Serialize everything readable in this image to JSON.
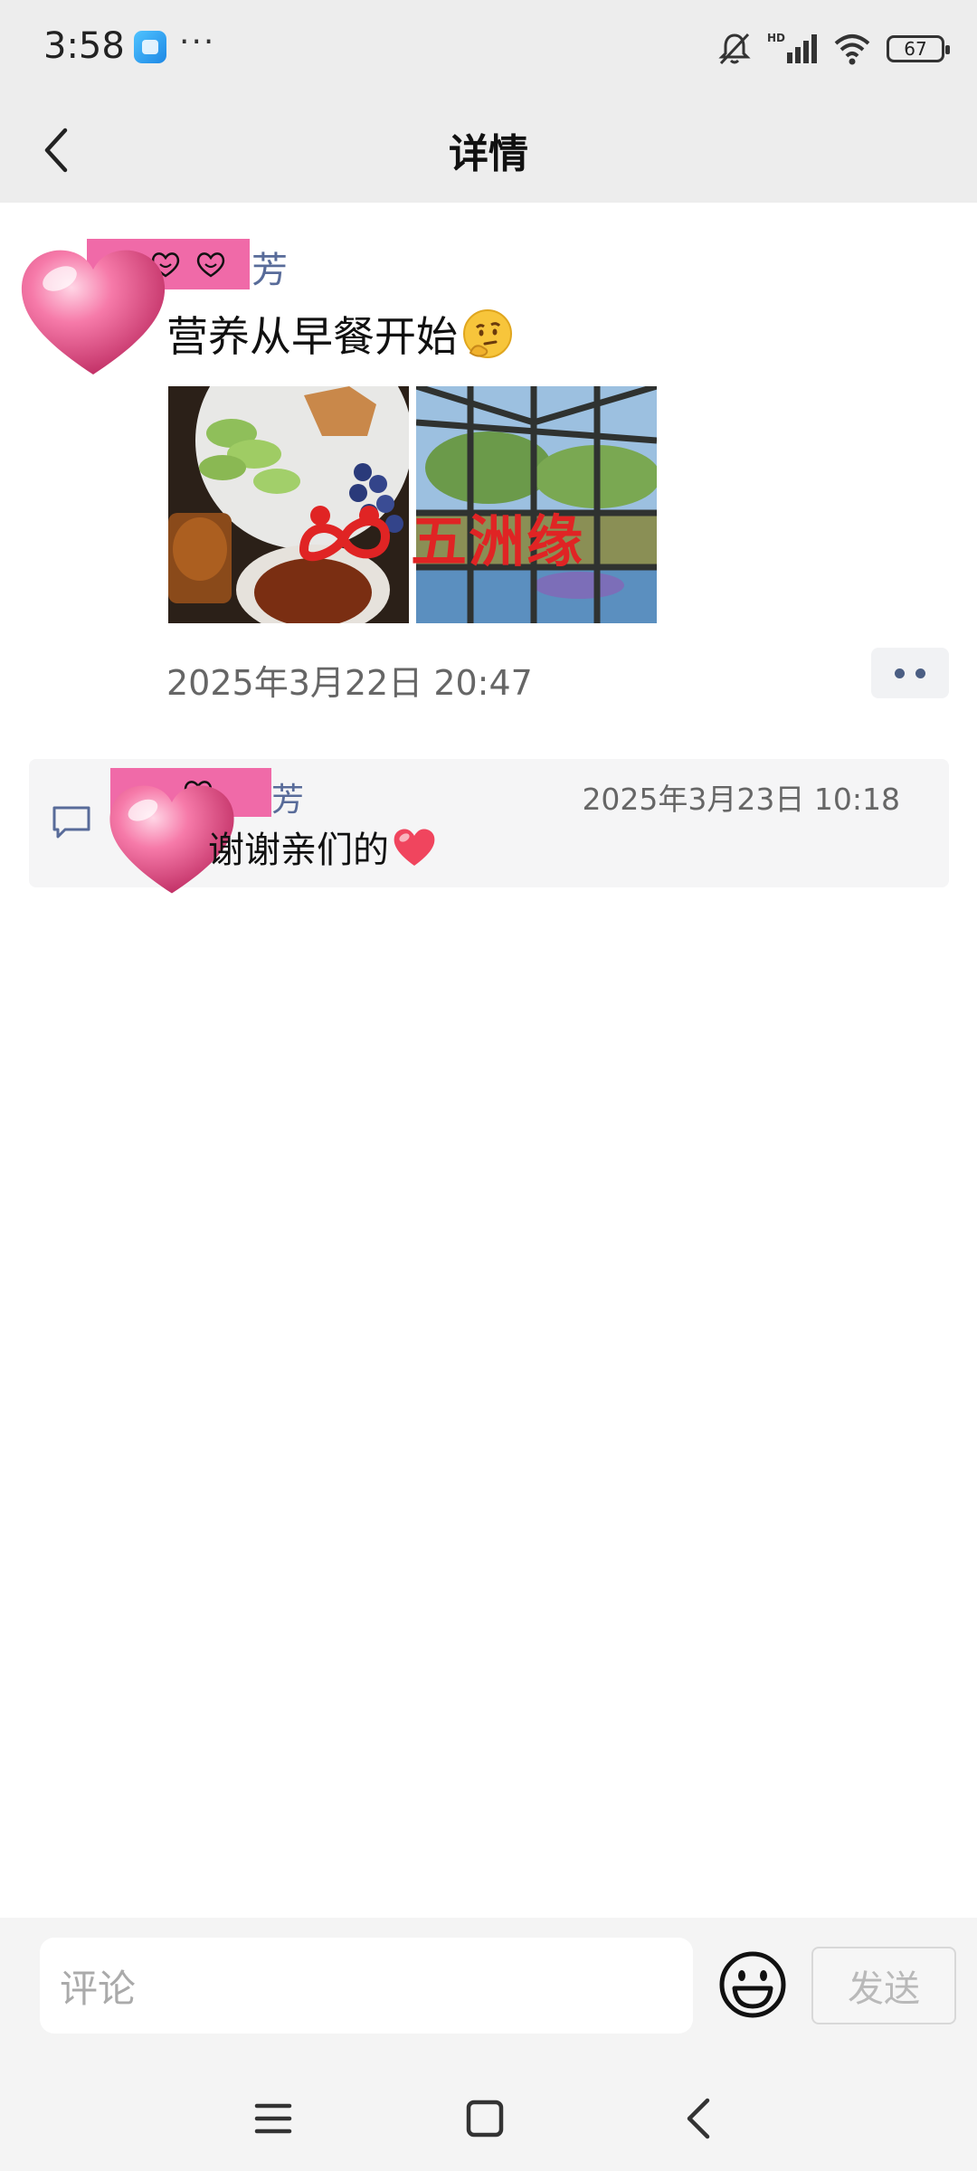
{
  "status_bar": {
    "time": "3:58",
    "more": "···",
    "network": "HD",
    "battery": "67"
  },
  "header": {
    "title": "详情"
  },
  "post": {
    "author_name": "芳",
    "text": "营养从早餐开始",
    "images": [
      "breakfast-photo",
      "garden-window-photo"
    ],
    "watermark": "五洲缘",
    "timestamp": "2025年3月22日 20:47"
  },
  "comments": [
    {
      "author_name": "芳",
      "timestamp": "2025年3月23日 10:18",
      "text": "谢谢亲们的"
    }
  ],
  "input": {
    "placeholder": "评论",
    "send_label": "发送"
  },
  "colors": {
    "accent_name": "#586b99",
    "name_tag_bg": "#f06aa8",
    "watermark": "#e02424"
  }
}
